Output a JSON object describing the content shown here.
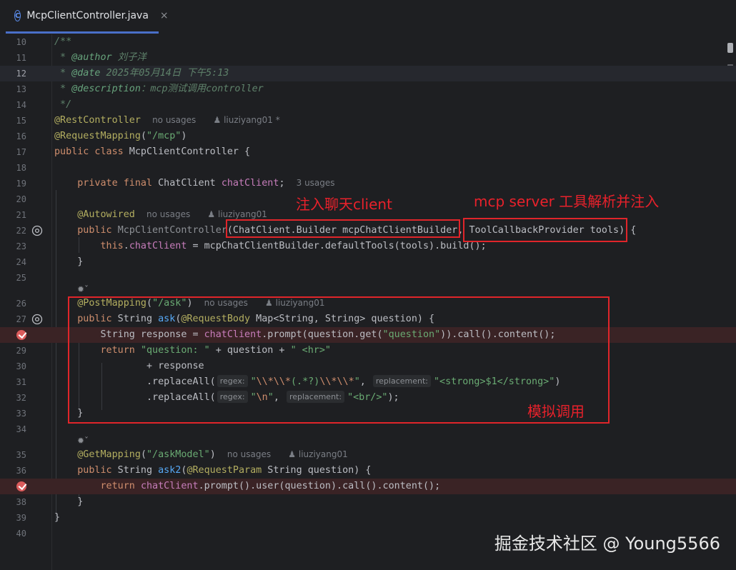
{
  "tab": {
    "icon_letter": "C",
    "label": "McpClientController.java",
    "close": "×"
  },
  "lines": [
    {
      "n": "10",
      "code": "/**"
    },
    {
      "n": "11",
      "code": " * @author 刘子洋"
    },
    {
      "n": "12",
      "code": " * @date 2025年05月14日 下午5:13"
    },
    {
      "n": "13",
      "code": " * @description：mcp测试调用controller"
    },
    {
      "n": "14",
      "code": " */"
    },
    {
      "n": "15",
      "code": "@RestController",
      "inline": "no usages   liuziyang01 *"
    },
    {
      "n": "16",
      "code": "@RequestMapping(\"/mcp\")"
    },
    {
      "n": "17",
      "code": "public class McpClientController {"
    },
    {
      "n": "18",
      "code": ""
    },
    {
      "n": "19",
      "code": "private final ChatClient chatClient;",
      "inline": "3 usages"
    },
    {
      "n": "20",
      "code": ""
    },
    {
      "n": "21",
      "code": "@Autowired",
      "inline": "no usages   liuziyang01"
    },
    {
      "n": "22",
      "code": "public McpClientController(ChatClient.Builder mcpChatClientBuilder, ToolCallbackProvider tools) {"
    },
    {
      "n": "23",
      "code": "this.chatClient = mcpChatClientBuilder.defaultTools(tools).build();"
    },
    {
      "n": "24",
      "code": "}"
    },
    {
      "n": "25",
      "code": ""
    },
    {
      "n": "26",
      "code": "@PostMapping(\"/ask\")",
      "inline": "no usages   liuziyang01"
    },
    {
      "n": "27",
      "code": "public String ask(@RequestBody Map<String, String> question) {"
    },
    {
      "n": "28",
      "code": "String response = chatClient.prompt(question.get(\"question\")).call().content();"
    },
    {
      "n": "29",
      "code": "return \"question: \" + question + \" <hr>\""
    },
    {
      "n": "30",
      "code": "+ response"
    },
    {
      "n": "31",
      "code": ".replaceAll( regex: \"\\\\*\\\\*(.*?)\\\\*\\\\*\",  replacement: \"<strong>$1</strong>\")"
    },
    {
      "n": "32",
      "code": ".replaceAll( regex: \"\\n\",  replacement: \"<br/>\");"
    },
    {
      "n": "33",
      "code": "}"
    },
    {
      "n": "34",
      "code": ""
    },
    {
      "n": "35",
      "code": "@GetMapping(\"/askModel\")",
      "inline": "no usages   liuziyang01"
    },
    {
      "n": "36",
      "code": "public String ask2(@RequestParam String question) {"
    },
    {
      "n": "37",
      "code": "return chatClient.prompt().user(question).call().content();"
    },
    {
      "n": "38",
      "code": "}"
    },
    {
      "n": "39",
      "code": "}"
    },
    {
      "n": "40",
      "code": ""
    }
  ],
  "inline": {
    "no_usages": "no usages",
    "author_line15": "liuziyang01 *",
    "author": "liuziyang01",
    "usages3": "3 usages",
    "regex_hint": "regex:",
    "replacement_hint": "replacement:"
  },
  "annotations": {
    "inject_client": "注入聊天client",
    "mcp_tools": "mcp server 工具解析并注入",
    "simulate_call": "模拟调用"
  },
  "watermark": "掘金技术社区 @ Young5566",
  "colors": {
    "annotation_red": "#e0252a",
    "breakpoint": "#db5c5c",
    "tab_accent": "#4a6fc8"
  }
}
